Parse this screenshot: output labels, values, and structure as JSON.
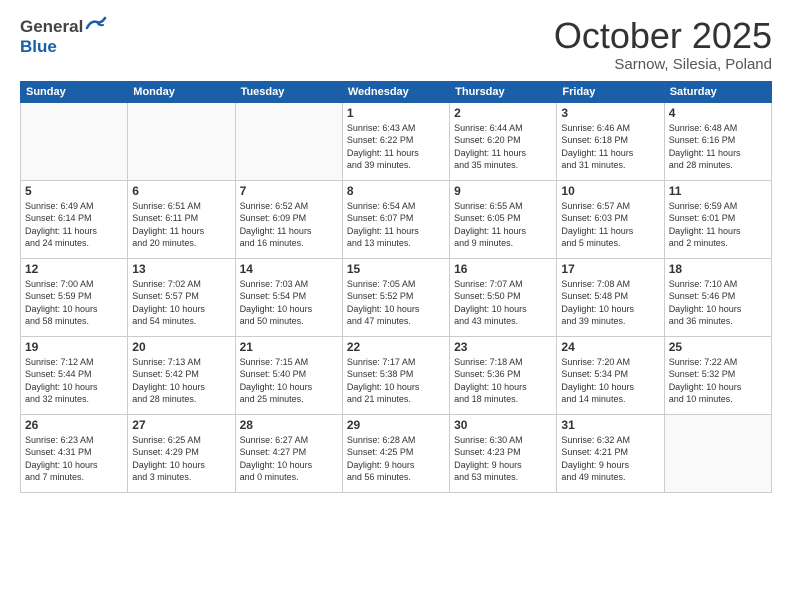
{
  "header": {
    "logo_general": "General",
    "logo_blue": "Blue",
    "month_title": "October 2025",
    "location": "Sarnow, Silesia, Poland"
  },
  "weekdays": [
    "Sunday",
    "Monday",
    "Tuesday",
    "Wednesday",
    "Thursday",
    "Friday",
    "Saturday"
  ],
  "weeks": [
    [
      {
        "day": "",
        "info": ""
      },
      {
        "day": "",
        "info": ""
      },
      {
        "day": "",
        "info": ""
      },
      {
        "day": "1",
        "info": "Sunrise: 6:43 AM\nSunset: 6:22 PM\nDaylight: 11 hours\nand 39 minutes."
      },
      {
        "day": "2",
        "info": "Sunrise: 6:44 AM\nSunset: 6:20 PM\nDaylight: 11 hours\nand 35 minutes."
      },
      {
        "day": "3",
        "info": "Sunrise: 6:46 AM\nSunset: 6:18 PM\nDaylight: 11 hours\nand 31 minutes."
      },
      {
        "day": "4",
        "info": "Sunrise: 6:48 AM\nSunset: 6:16 PM\nDaylight: 11 hours\nand 28 minutes."
      }
    ],
    [
      {
        "day": "5",
        "info": "Sunrise: 6:49 AM\nSunset: 6:14 PM\nDaylight: 11 hours\nand 24 minutes."
      },
      {
        "day": "6",
        "info": "Sunrise: 6:51 AM\nSunset: 6:11 PM\nDaylight: 11 hours\nand 20 minutes."
      },
      {
        "day": "7",
        "info": "Sunrise: 6:52 AM\nSunset: 6:09 PM\nDaylight: 11 hours\nand 16 minutes."
      },
      {
        "day": "8",
        "info": "Sunrise: 6:54 AM\nSunset: 6:07 PM\nDaylight: 11 hours\nand 13 minutes."
      },
      {
        "day": "9",
        "info": "Sunrise: 6:55 AM\nSunset: 6:05 PM\nDaylight: 11 hours\nand 9 minutes."
      },
      {
        "day": "10",
        "info": "Sunrise: 6:57 AM\nSunset: 6:03 PM\nDaylight: 11 hours\nand 5 minutes."
      },
      {
        "day": "11",
        "info": "Sunrise: 6:59 AM\nSunset: 6:01 PM\nDaylight: 11 hours\nand 2 minutes."
      }
    ],
    [
      {
        "day": "12",
        "info": "Sunrise: 7:00 AM\nSunset: 5:59 PM\nDaylight: 10 hours\nand 58 minutes."
      },
      {
        "day": "13",
        "info": "Sunrise: 7:02 AM\nSunset: 5:57 PM\nDaylight: 10 hours\nand 54 minutes."
      },
      {
        "day": "14",
        "info": "Sunrise: 7:03 AM\nSunset: 5:54 PM\nDaylight: 10 hours\nand 50 minutes."
      },
      {
        "day": "15",
        "info": "Sunrise: 7:05 AM\nSunset: 5:52 PM\nDaylight: 10 hours\nand 47 minutes."
      },
      {
        "day": "16",
        "info": "Sunrise: 7:07 AM\nSunset: 5:50 PM\nDaylight: 10 hours\nand 43 minutes."
      },
      {
        "day": "17",
        "info": "Sunrise: 7:08 AM\nSunset: 5:48 PM\nDaylight: 10 hours\nand 39 minutes."
      },
      {
        "day": "18",
        "info": "Sunrise: 7:10 AM\nSunset: 5:46 PM\nDaylight: 10 hours\nand 36 minutes."
      }
    ],
    [
      {
        "day": "19",
        "info": "Sunrise: 7:12 AM\nSunset: 5:44 PM\nDaylight: 10 hours\nand 32 minutes."
      },
      {
        "day": "20",
        "info": "Sunrise: 7:13 AM\nSunset: 5:42 PM\nDaylight: 10 hours\nand 28 minutes."
      },
      {
        "day": "21",
        "info": "Sunrise: 7:15 AM\nSunset: 5:40 PM\nDaylight: 10 hours\nand 25 minutes."
      },
      {
        "day": "22",
        "info": "Sunrise: 7:17 AM\nSunset: 5:38 PM\nDaylight: 10 hours\nand 21 minutes."
      },
      {
        "day": "23",
        "info": "Sunrise: 7:18 AM\nSunset: 5:36 PM\nDaylight: 10 hours\nand 18 minutes."
      },
      {
        "day": "24",
        "info": "Sunrise: 7:20 AM\nSunset: 5:34 PM\nDaylight: 10 hours\nand 14 minutes."
      },
      {
        "day": "25",
        "info": "Sunrise: 7:22 AM\nSunset: 5:32 PM\nDaylight: 10 hours\nand 10 minutes."
      }
    ],
    [
      {
        "day": "26",
        "info": "Sunrise: 6:23 AM\nSunset: 4:31 PM\nDaylight: 10 hours\nand 7 minutes."
      },
      {
        "day": "27",
        "info": "Sunrise: 6:25 AM\nSunset: 4:29 PM\nDaylight: 10 hours\nand 3 minutes."
      },
      {
        "day": "28",
        "info": "Sunrise: 6:27 AM\nSunset: 4:27 PM\nDaylight: 10 hours\nand 0 minutes."
      },
      {
        "day": "29",
        "info": "Sunrise: 6:28 AM\nSunset: 4:25 PM\nDaylight: 9 hours\nand 56 minutes."
      },
      {
        "day": "30",
        "info": "Sunrise: 6:30 AM\nSunset: 4:23 PM\nDaylight: 9 hours\nand 53 minutes."
      },
      {
        "day": "31",
        "info": "Sunrise: 6:32 AM\nSunset: 4:21 PM\nDaylight: 9 hours\nand 49 minutes."
      },
      {
        "day": "",
        "info": ""
      }
    ]
  ]
}
